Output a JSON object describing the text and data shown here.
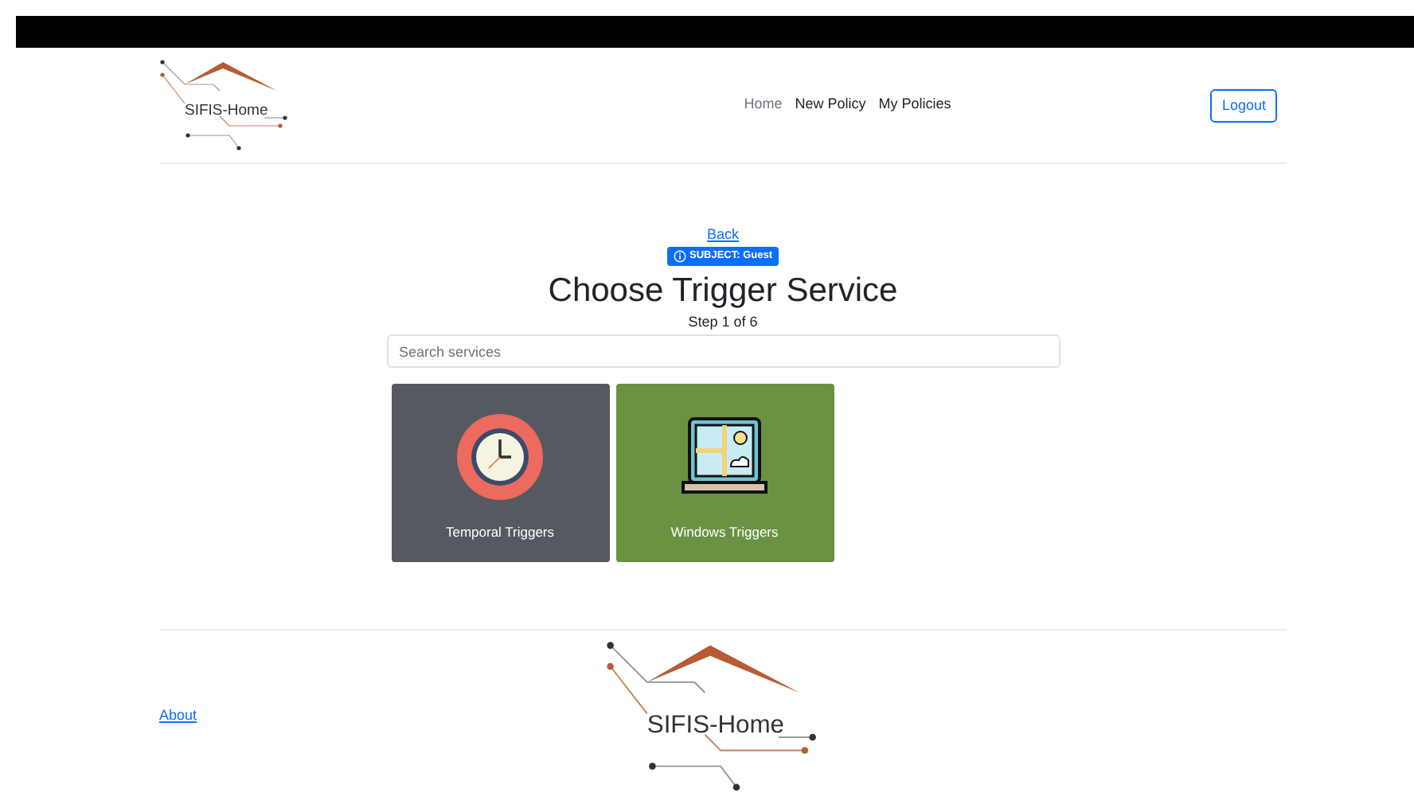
{
  "header": {
    "logo_text": "SIFIS-Home",
    "nav": [
      {
        "label": "Home",
        "selected": true
      },
      {
        "label": "New Policy",
        "selected": false
      },
      {
        "label": "My Policies",
        "selected": false
      }
    ],
    "logout": "Logout"
  },
  "main": {
    "back": "Back",
    "badge": "SUBJECT: Guest",
    "title": "Choose Trigger Service",
    "step": "Step 1 of 6",
    "search": {
      "placeholder": "Search services"
    },
    "services": [
      {
        "label": "Temporal Triggers",
        "kind": "clock",
        "color": "#565960"
      },
      {
        "label": "Windows Triggers",
        "kind": "window",
        "color": "#6a9243"
      }
    ]
  },
  "footer": {
    "link": "About",
    "logo_text": "SIFIS-Home"
  }
}
